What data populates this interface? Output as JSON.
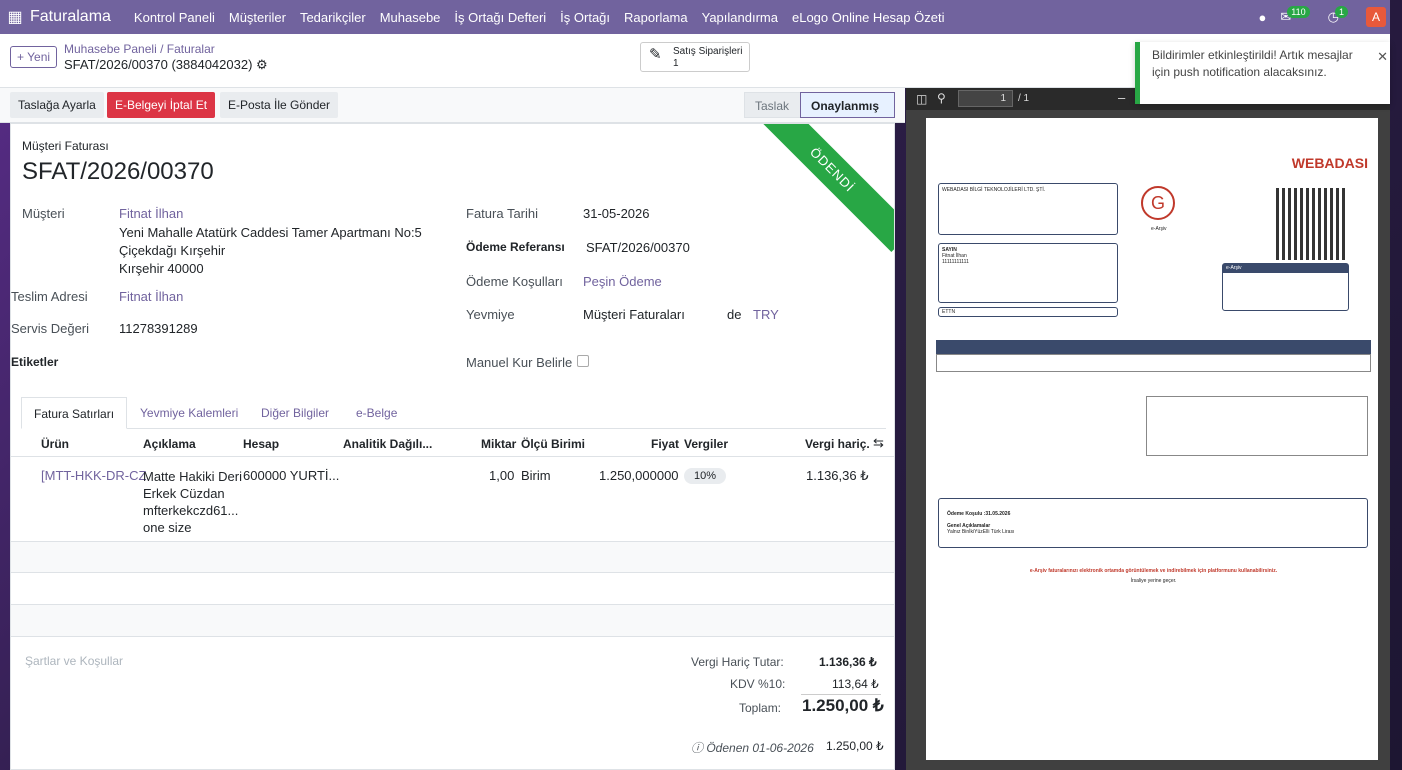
{
  "nav": {
    "brand": "Faturalama",
    "items": [
      "Kontrol Paneli",
      "Müşteriler",
      "Tedarikçiler",
      "Muhasebe",
      "İş Ortağı Defteri",
      "İş Ortağı",
      "Raporlama",
      "Yapılandırma",
      "eLogo Online Hesap Özeti"
    ],
    "msg_count": "110",
    "activity_count": "1",
    "avatar": "A"
  },
  "control": {
    "new_label": "+ Yeni",
    "breadcrumb_parent": "Muhasebe Paneli / Faturalar",
    "breadcrumb_current": "SFAT/2026/00370 (3884042032)",
    "smart_label": "Satış Siparişleri",
    "smart_count": "1"
  },
  "notification": {
    "text": "Bildirimler etkinleştirildi! Artık mesajlar için push notification alacaksınız."
  },
  "statusbar": {
    "btn1": "Taslağa Ayarla",
    "btn2": "E-Belgeyi İptal Et",
    "btn3": "E-Posta İle Gönder",
    "stage1": "Taslak",
    "stage2": "Onaylanmış"
  },
  "form": {
    "ribbon": "ÖDENDİ",
    "type": "Müşteri Faturası",
    "number": "SFAT/2026/00370",
    "customer_label": "Müşteri",
    "customer": "Fitnat İlhan",
    "addr1": "Yeni Mahalle Atatürk Caddesi Tamer Apartmanı No:5",
    "addr2": "Çiçekdağı Kırşehir",
    "addr3": "Kırşehir 40000",
    "delivery_label": "Teslim Adresi",
    "delivery": "Fitnat İlhan",
    "service_label": "Servis Değeri",
    "service": "11278391289",
    "tags_label": "Etiketler",
    "date_label": "Fatura Tarihi",
    "date": "31-05-2026",
    "payref_label": "Ödeme Referansı",
    "payref": "SFAT/2026/00370",
    "terms_label": "Ödeme Koşulları",
    "terms": "Peşin Ödeme",
    "journal_label": "Yevmiye",
    "journal": "Müşteri Faturaları",
    "in": "de",
    "currency": "TRY",
    "manual_label": "Manuel Kur Belirle"
  },
  "tabs": [
    "Fatura Satırları",
    "Yevmiye Kalemleri",
    "Diğer Bilgiler",
    "e-Belge"
  ],
  "table": {
    "headers": [
      "Ürün",
      "Açıklama",
      "Hesap",
      "Analitik Dağılı...",
      "Miktar",
      "Ölçü Birimi",
      "Fiyat",
      "Vergiler",
      "Vergi hariç."
    ],
    "row": {
      "product": "[MTT-HKK-DR-CZ",
      "desc1": "Matte Hakiki Deri",
      "desc2": "Erkek Cüzdan",
      "desc3": "mfterkekczd61...",
      "desc4": "one size",
      "account": "600000 YURTİ...",
      "qty": "1,00",
      "uom": "Birim",
      "price": "1.250,000000",
      "tax": "10%",
      "subtotal": "1.136,36 ₺"
    }
  },
  "totals": {
    "terms_placeholder": "Şartlar ve Koşullar",
    "untaxed_label": "Vergi Hariç Tutar:",
    "untaxed": "1.136,36 ₺",
    "kdv_label": "KDV %10:",
    "kdv": "113,64 ₺",
    "total_label": "Toplam:",
    "total": "1.250,00 ₺",
    "paid_label": "Ödenen 01-06-2026",
    "paid": "1.250,00 ₺"
  },
  "pdf": {
    "page": "1",
    "pages": "/ 1",
    "logo": "WEBADASI",
    "seller": "WEBADASI BİLGİ TEKNOLOJİLERİ LTD. ŞTİ.",
    "buyer_title": "SAYIN",
    "buyer": "Fitnat İlhan",
    "earsiv": "e-Arşiv",
    "ettn_label": "ETTN",
    "vkn": "11111111111",
    "footer_note": "e-Arşiv faturalarınızı elektronik ortamda görüntülemek ve indirebilmek için platformunu kullanabilirsiniz.",
    "irsaliye": "İrsaliye yerine geçer.",
    "payment_line": "Ödeme Koşulu :31.05.2026",
    "general_label": "Genel Açıklamalar",
    "general_text": "Yalnız BinİkiYüzElli Türk Lirası"
  }
}
